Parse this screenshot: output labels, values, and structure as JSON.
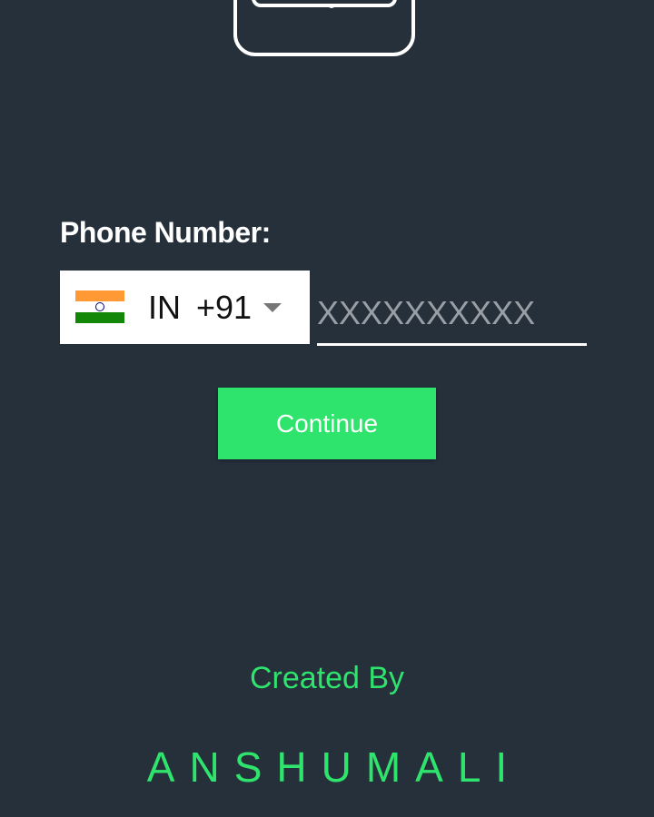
{
  "form": {
    "label": "Phone Number:",
    "country_code": "IN",
    "dial_code": "+91",
    "phone_placeholder": "XXXXXXXXXX",
    "phone_value": "",
    "continue_label": "Continue"
  },
  "credits": {
    "created_by": "Created By",
    "author": "ANSHUMALI"
  },
  "icons": {
    "header": "phone-icon",
    "flag": "india-flag-icon",
    "dropdown": "caret-down-icon"
  },
  "colors": {
    "background": "#25303b",
    "accent": "#2fe46c",
    "text": "#ffffff"
  }
}
